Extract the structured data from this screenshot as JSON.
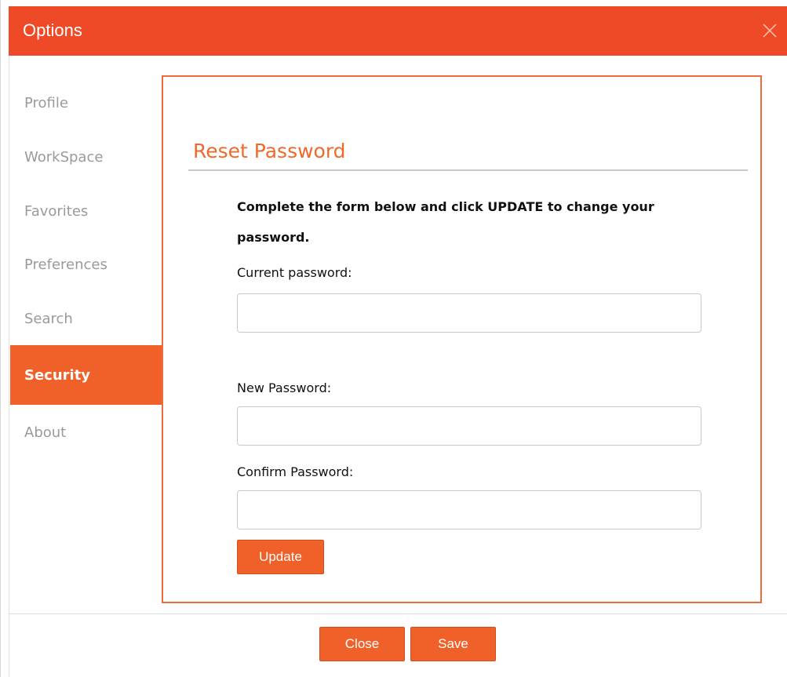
{
  "window": {
    "title": "Options",
    "close_icon": "close-icon",
    "accent_color": "#ef4a28"
  },
  "sidebar": {
    "items": [
      {
        "label": "Profile",
        "active": false
      },
      {
        "label": "WorkSpace",
        "active": false
      },
      {
        "label": "Favorites",
        "active": false
      },
      {
        "label": "Preferences",
        "active": false
      },
      {
        "label": "Search",
        "active": false
      },
      {
        "label": "Security",
        "active": true
      },
      {
        "label": "About",
        "active": false
      }
    ],
    "active_color": "#f0612a"
  },
  "panel": {
    "title": "Reset Password",
    "instructions": "Complete the form below and click UPDATE to change your password.",
    "fields": {
      "current": {
        "label": "Current password:",
        "value": "",
        "placeholder": ""
      },
      "new": {
        "label": "New Password:",
        "value": "",
        "placeholder": ""
      },
      "confirm": {
        "label": "Confirm Password:",
        "value": "",
        "placeholder": ""
      }
    },
    "update_label": "Update"
  },
  "footer": {
    "close_label": "Close",
    "save_label": "Save"
  }
}
